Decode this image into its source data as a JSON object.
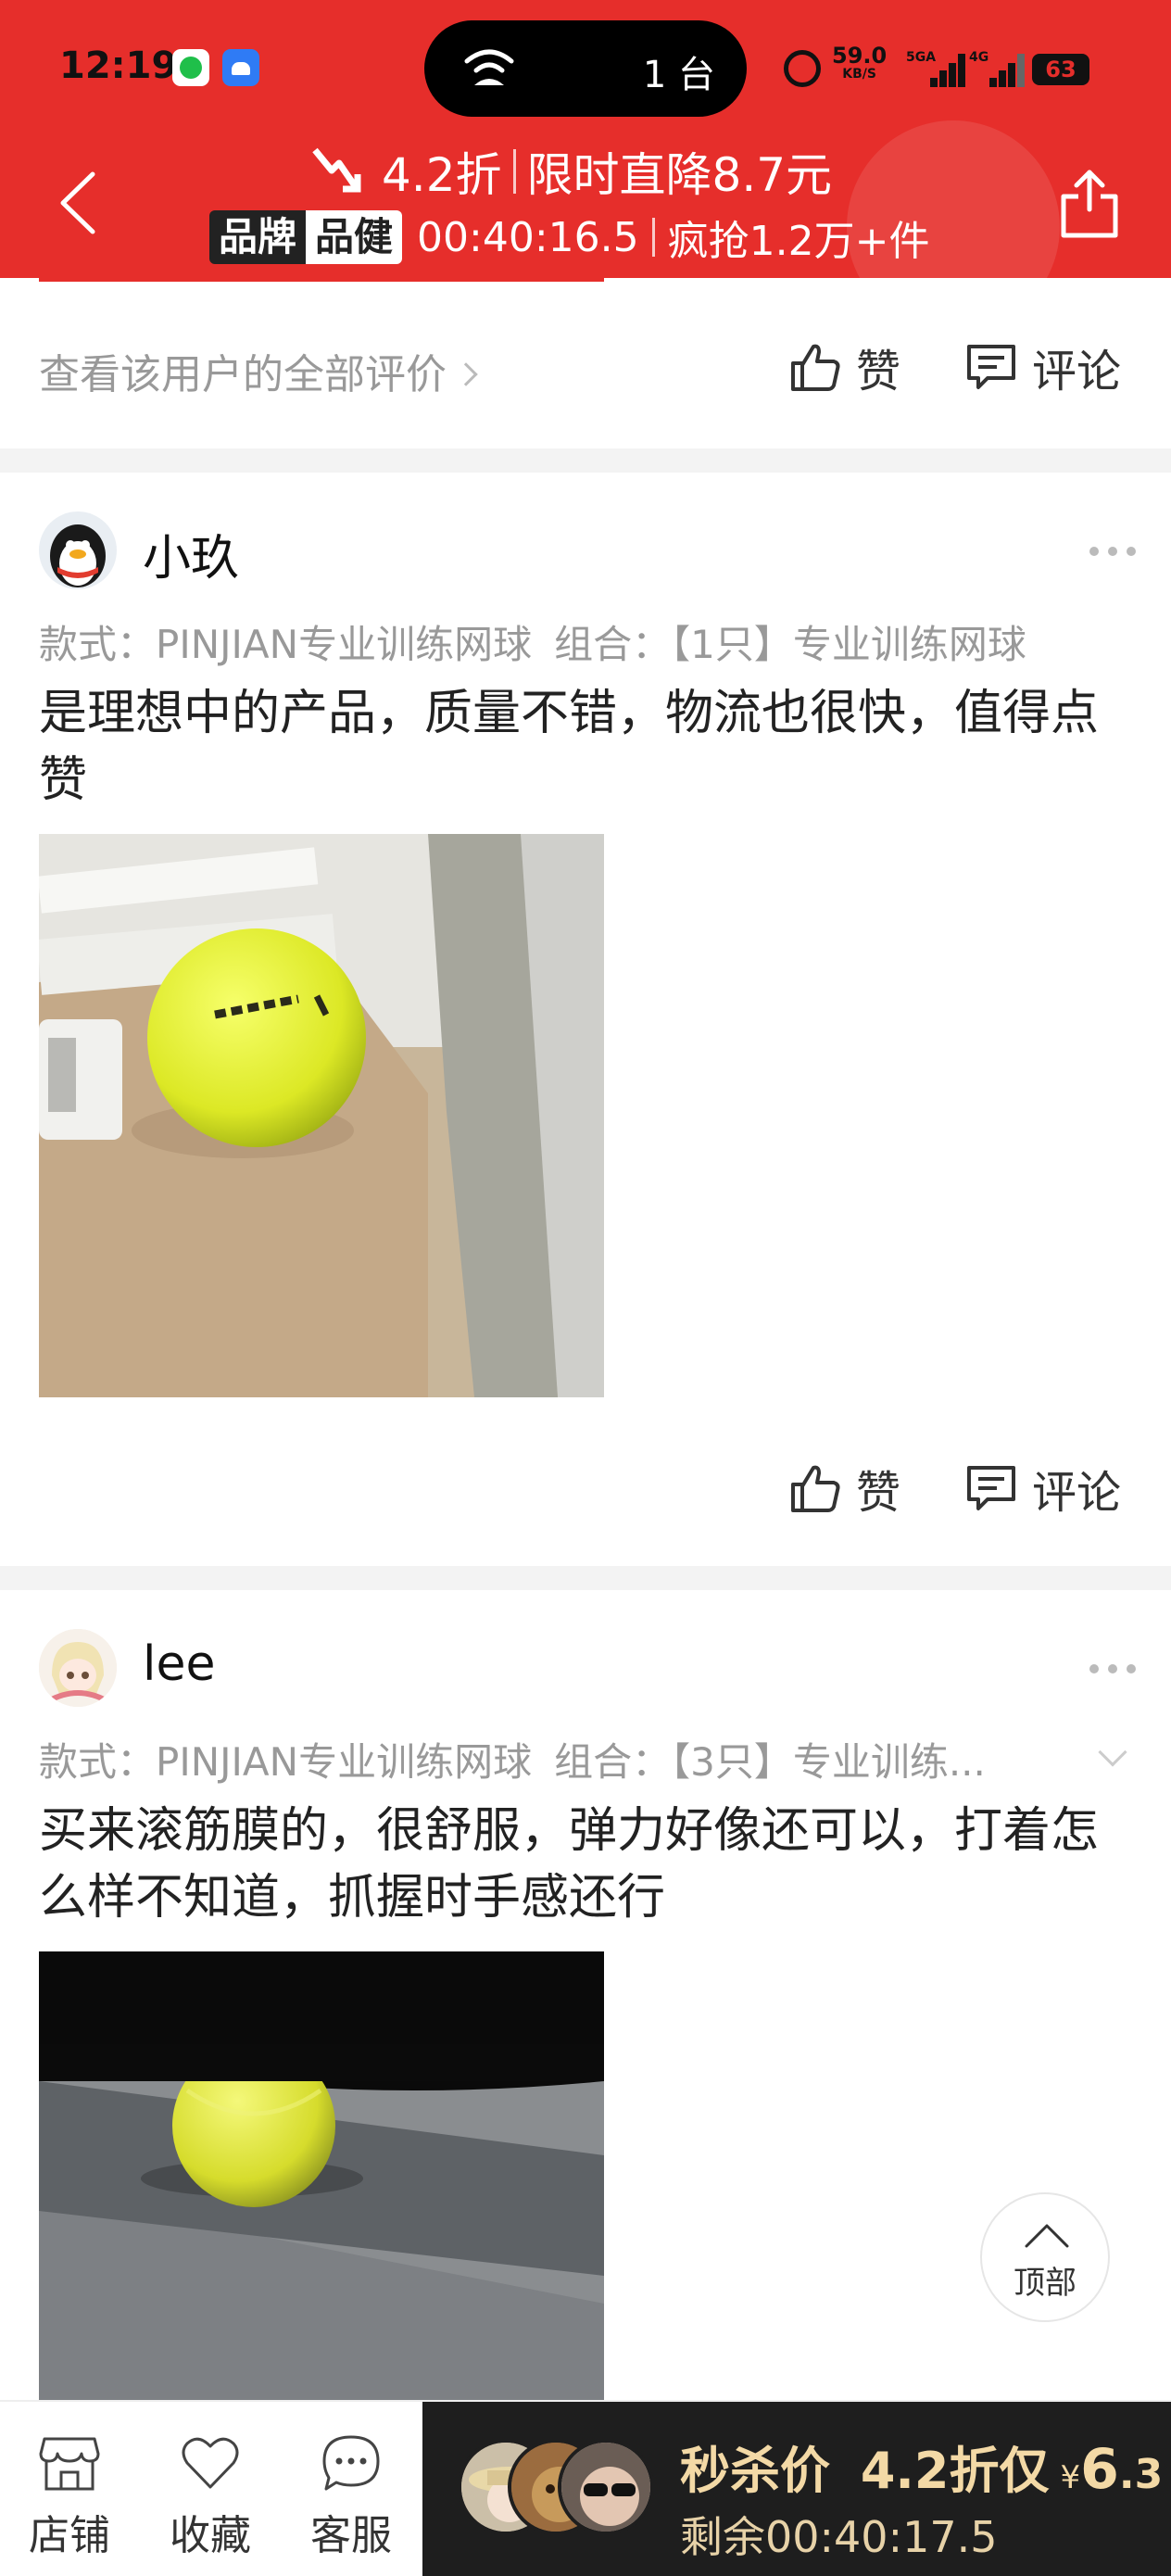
{
  "status_bar": {
    "time": "12:19",
    "island_text": "1 台",
    "net_speed": "59.0",
    "net_unit": "KB/S",
    "sig1_tag": "5GA",
    "sig2_tag": "4G",
    "battery": "63"
  },
  "header": {
    "discount": "4.2折",
    "drop": "限时直降8.7元",
    "brand_tag_1": "品牌",
    "brand_tag_2": "品健",
    "countdown": "00:40:16.5",
    "sold": "疯抢1.2万+件",
    "bg_color": "#e62e2b"
  },
  "actions": {
    "view_all": "查看该用户的全部评价",
    "like": "赞",
    "comment": "评论"
  },
  "reviews": [
    {
      "username": "小玖",
      "sku_label_1": "款式：",
      "sku_value_1": "PINJIAN专业训练网球",
      "sku_label_2": "组合：",
      "sku_value_2": "【1只】专业训练网球",
      "text": "是理想中的产品，质量不错，物流也很快，值得点赞"
    },
    {
      "username": "lee",
      "sku_label_1": "款式：",
      "sku_value_1": "PINJIAN专业训练网球",
      "sku_label_2": "组合：",
      "sku_value_2": "【3只】专业训练...",
      "text": "买来滚筋膜的，很舒服，弹力好像还可以，打着怎么样不知道，抓握时手感还行"
    }
  ],
  "top_button": "顶部",
  "bottom_bar": {
    "shop": "店铺",
    "favorite": "收藏",
    "service": "客服",
    "seckill_label": "秒杀价",
    "seckill_discount": "4.2折仅",
    "currency": "¥",
    "price_int": "6",
    "price_dec": ".3",
    "remain": "剩余00:40:17.5",
    "gold_color": "#f3d9a6"
  }
}
